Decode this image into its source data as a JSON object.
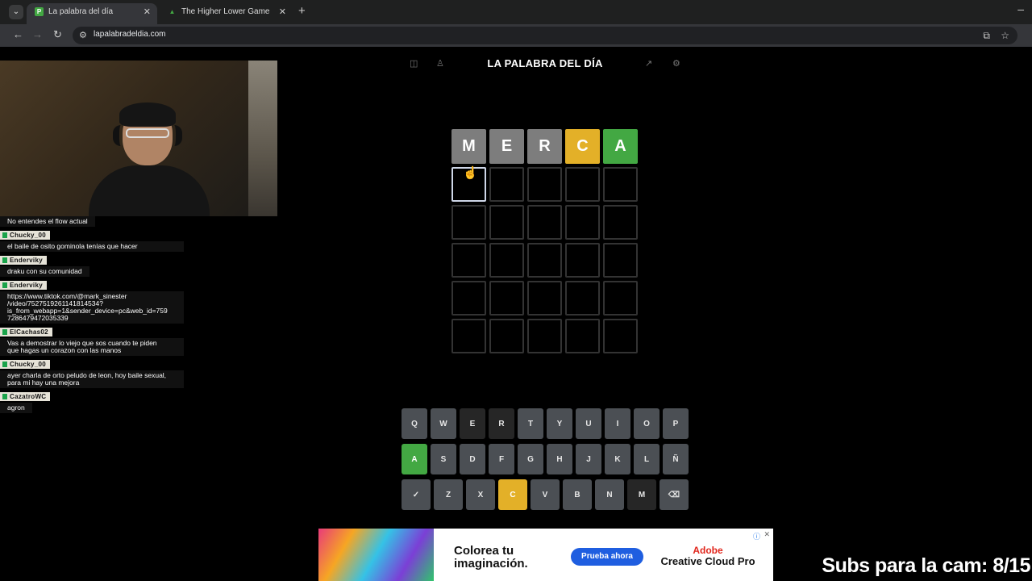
{
  "browser": {
    "tabs": [
      {
        "title": "La palabra del día",
        "favicon": "P"
      },
      {
        "title": "The Higher Lower Game",
        "favicon": "▲"
      }
    ],
    "url": "lapalabradeldia.com"
  },
  "game": {
    "title": "LA PALABRA DEL DÍA",
    "rows": [
      [
        {
          "l": "M",
          "s": "gray"
        },
        {
          "l": "E",
          "s": "gray"
        },
        {
          "l": "R",
          "s": "gray"
        },
        {
          "l": "C",
          "s": "yellow"
        },
        {
          "l": "A",
          "s": "green"
        }
      ],
      [
        {
          "l": "",
          "s": "active"
        },
        {
          "l": "",
          "s": ""
        },
        {
          "l": "",
          "s": ""
        },
        {
          "l": "",
          "s": ""
        },
        {
          "l": "",
          "s": ""
        }
      ],
      [
        {
          "l": "",
          "s": ""
        },
        {
          "l": "",
          "s": ""
        },
        {
          "l": "",
          "s": ""
        },
        {
          "l": "",
          "s": ""
        },
        {
          "l": "",
          "s": ""
        }
      ],
      [
        {
          "l": "",
          "s": ""
        },
        {
          "l": "",
          "s": ""
        },
        {
          "l": "",
          "s": ""
        },
        {
          "l": "",
          "s": ""
        },
        {
          "l": "",
          "s": ""
        }
      ],
      [
        {
          "l": "",
          "s": ""
        },
        {
          "l": "",
          "s": ""
        },
        {
          "l": "",
          "s": ""
        },
        {
          "l": "",
          "s": ""
        },
        {
          "l": "",
          "s": ""
        }
      ],
      [
        {
          "l": "",
          "s": ""
        },
        {
          "l": "",
          "s": ""
        },
        {
          "l": "",
          "s": ""
        },
        {
          "l": "",
          "s": ""
        },
        {
          "l": "",
          "s": ""
        }
      ]
    ],
    "keyboard": [
      [
        {
          "k": "Q",
          "s": ""
        },
        {
          "k": "W",
          "s": ""
        },
        {
          "k": "E",
          "s": "used"
        },
        {
          "k": "R",
          "s": "used"
        },
        {
          "k": "T",
          "s": ""
        },
        {
          "k": "Y",
          "s": ""
        },
        {
          "k": "U",
          "s": ""
        },
        {
          "k": "I",
          "s": ""
        },
        {
          "k": "O",
          "s": ""
        },
        {
          "k": "P",
          "s": ""
        }
      ],
      [
        {
          "k": "A",
          "s": "green"
        },
        {
          "k": "S",
          "s": ""
        },
        {
          "k": "D",
          "s": ""
        },
        {
          "k": "F",
          "s": ""
        },
        {
          "k": "G",
          "s": ""
        },
        {
          "k": "H",
          "s": ""
        },
        {
          "k": "J",
          "s": ""
        },
        {
          "k": "K",
          "s": ""
        },
        {
          "k": "L",
          "s": ""
        },
        {
          "k": "Ñ",
          "s": ""
        }
      ],
      [
        {
          "k": "✓",
          "s": "",
          "name": "enter"
        },
        {
          "k": "Z",
          "s": ""
        },
        {
          "k": "X",
          "s": ""
        },
        {
          "k": "C",
          "s": "yellow"
        },
        {
          "k": "V",
          "s": ""
        },
        {
          "k": "B",
          "s": ""
        },
        {
          "k": "N",
          "s": ""
        },
        {
          "k": "M",
          "s": "used"
        },
        {
          "k": "⌫",
          "s": "",
          "name": "backspace"
        }
      ]
    ]
  },
  "chat": {
    "first_message": "No entendes el flow actual",
    "messages": [
      {
        "user": "Chucky_00",
        "text": "el baile de osito gominola tenías que hacer"
      },
      {
        "user": "Enderviky",
        "text": "draku con su comunidad"
      },
      {
        "user": "Enderviky",
        "text": "https://www.tiktok.com/@mark_sinester\n/video/7527519261141814534?\nis_from_webapp=1&sender_device=pc&web_id=759\n7286479472035339"
      },
      {
        "user": "ElCachas02",
        "text": "Vas a demostrar lo viejo que sos cuando te piden\nque hagas un corazon con las manos"
      },
      {
        "user": "Chucky_00",
        "text": "ayer charla de orto peludo de leon, hoy baile sexual,\npara mi hay una mejora"
      },
      {
        "user": "CazatroWC",
        "text": "agron"
      }
    ]
  },
  "ad": {
    "headline": "Colorea tu\nimaginación.",
    "button": "Prueba ahora",
    "brand_line1": "Adobe",
    "brand_line2": "Creative Cloud Pro"
  },
  "overlay": {
    "subs_text": "Subs para la cam: 8/15"
  },
  "colors": {
    "gray_tile": "#7d7d7d",
    "yellow_tile": "#e3b028",
    "green_tile": "#43a843",
    "key": "#4b4f54",
    "key_used": "#262626"
  }
}
